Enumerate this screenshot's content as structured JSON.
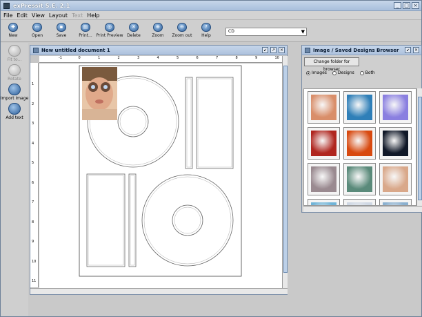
{
  "app": {
    "title": "exPressit S.E. 2.1"
  },
  "window_controls": {
    "minimize": "_",
    "maximize": "□",
    "close": "×"
  },
  "menu": [
    {
      "label": "File",
      "enabled": true
    },
    {
      "label": "Edit",
      "enabled": true
    },
    {
      "label": "View",
      "enabled": true
    },
    {
      "label": "Layout",
      "enabled": true
    },
    {
      "label": "Text",
      "enabled": false
    },
    {
      "label": "Help",
      "enabled": true
    }
  ],
  "toolbar": {
    "items": [
      {
        "label": "New",
        "icon": "new-doc-icon",
        "glyph": "✚"
      },
      {
        "label": "Open",
        "icon": "open-folder-icon",
        "glyph": "▭"
      },
      {
        "label": "Save",
        "icon": "save-disk-icon",
        "glyph": "▪"
      },
      {
        "label": "Print...",
        "icon": "printer-icon",
        "glyph": "▤"
      },
      {
        "label": "Print Preview",
        "icon": "print-preview-icon",
        "glyph": "◎"
      },
      {
        "label": "Delete",
        "icon": "delete-x-icon",
        "glyph": "✕"
      },
      {
        "label": "Zoom",
        "icon": "zoom-icon",
        "glyph": "⊕"
      },
      {
        "label": "Zoom out",
        "icon": "zoom-out-icon",
        "glyph": "⊖"
      },
      {
        "label": "Help",
        "icon": "help-icon",
        "glyph": "?"
      }
    ],
    "template_select": "CD"
  },
  "sidebar": {
    "items": [
      {
        "label": "Fit to...",
        "enabled": false,
        "icon": "fit-to-icon"
      },
      {
        "label": "Rotate",
        "enabled": false,
        "icon": "rotate-icon"
      },
      {
        "label": "Import Image",
        "enabled": true,
        "icon": "import-image-icon"
      },
      {
        "label": "Add text",
        "enabled": true,
        "icon": "add-text-icon"
      }
    ]
  },
  "document": {
    "title": "New untitled document 1",
    "ruler_labels": [
      "-1",
      "0",
      "1",
      "2",
      "3",
      "4",
      "5",
      "6",
      "7",
      "8",
      "9",
      "10"
    ],
    "vruler_labels": [
      "1",
      "2",
      "3",
      "4",
      "5",
      "6",
      "7",
      "8",
      "9",
      "10",
      "11"
    ]
  },
  "browser": {
    "title": "Image / Saved Designs Browser",
    "change_folder_label": "Change folder for browser",
    "radios": [
      {
        "label": "Images",
        "selected": true
      },
      {
        "label": "Designs",
        "selected": false
      },
      {
        "label": "Both",
        "selected": false
      }
    ],
    "thumbnails": [
      {
        "name": "hand",
        "color": "#d98e6a"
      },
      {
        "name": "blue-spheres",
        "color": "#2f7fb8"
      },
      {
        "name": "purple-glow",
        "color": "#8a7fe0"
      },
      {
        "name": "red-abstract",
        "color": "#b0261f"
      },
      {
        "name": "red-orb",
        "color": "#d84a10"
      },
      {
        "name": "dark-shapes",
        "color": "#101828"
      },
      {
        "name": "car",
        "color": "#9a8a90"
      },
      {
        "name": "peacock",
        "color": "#5a8a7a"
      },
      {
        "name": "child-face",
        "color": "#d9a88a"
      },
      {
        "name": "partial-1",
        "color": "#6fb4d8"
      },
      {
        "name": "partial-2",
        "color": "#cfd8e4"
      },
      {
        "name": "partial-3",
        "color": "#8ab0d0"
      }
    ]
  }
}
